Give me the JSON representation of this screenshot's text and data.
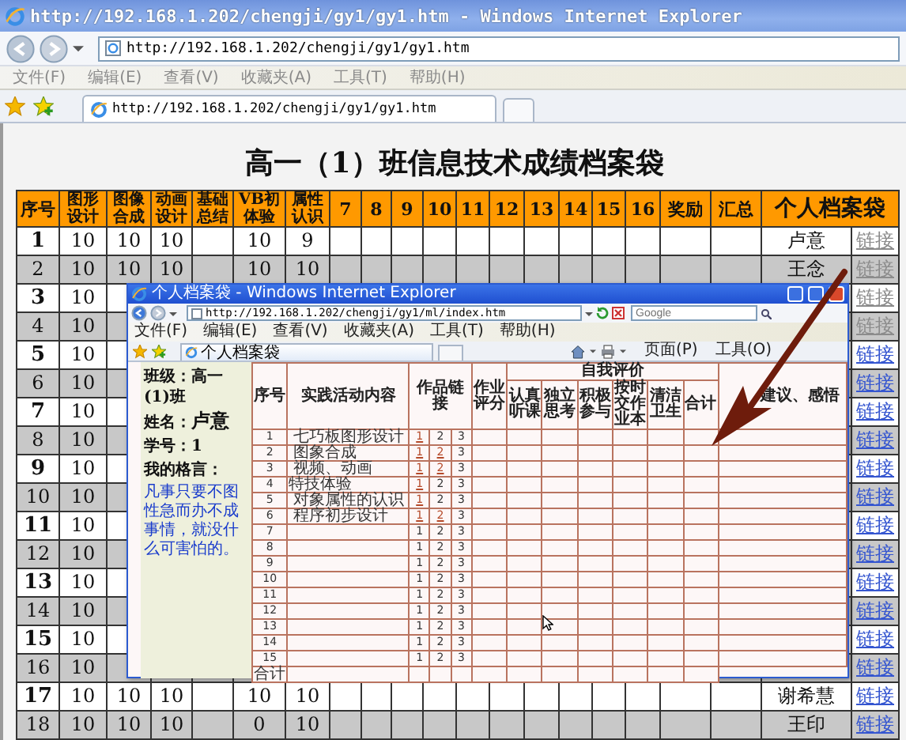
{
  "window": {
    "title": "http://192.168.1.202/chengji/gy1/gy1.htm - Windows Internet Explorer",
    "address": "http://192.168.1.202/chengji/gy1/gy1.htm",
    "menu": [
      "文件(F)",
      "编辑(E)",
      "查看(V)",
      "收藏夹(A)",
      "工具(T)",
      "帮助(H)"
    ],
    "tab": "http://192.168.1.202/chengji/gy1/gy1.htm"
  },
  "page": {
    "title": "高一（1）班信息技术成绩档案袋",
    "table": {
      "columns": [
        "序号",
        "图形设计",
        "图像合成",
        "动画设计",
        "基础总结",
        "VB初体验",
        "属性认识",
        "7",
        "8",
        "9",
        "10",
        "11",
        "12",
        "13",
        "14",
        "15",
        "16",
        "奖励",
        "汇总",
        "个人档案袋"
      ],
      "rows": [
        {
          "no": "1",
          "scores": [
            "10",
            "10",
            "10"
          ],
          "scores_after_gap": [
            "10",
            "9"
          ],
          "name": "卢意",
          "link": "链接",
          "visited": true
        },
        {
          "no": "2",
          "scores": [
            "10",
            "10",
            "10"
          ],
          "scores_after_gap": [
            "10",
            "10"
          ],
          "name": "王念",
          "link": "链接",
          "visited": true
        },
        {
          "no": "3",
          "scores": [
            "10"
          ],
          "link": "链接",
          "visited": true
        },
        {
          "no": "4",
          "scores": [
            "10"
          ],
          "link": "链接",
          "visited": true
        },
        {
          "no": "5",
          "scores": [
            "10"
          ],
          "link": "链接",
          "visited": false
        },
        {
          "no": "6",
          "scores": [
            "10"
          ],
          "link": "链接",
          "visited": false
        },
        {
          "no": "7",
          "scores": [
            "10"
          ],
          "link": "链接",
          "visited": false
        },
        {
          "no": "8",
          "scores": [
            "10"
          ],
          "link": "链接",
          "visited": false
        },
        {
          "no": "9",
          "scores": [
            "10"
          ],
          "link": "链接",
          "visited": false
        },
        {
          "no": "10",
          "scores": [
            "10"
          ],
          "link": "链接",
          "visited": false
        },
        {
          "no": "11",
          "scores": [
            "10"
          ],
          "link": "链接",
          "visited": false
        },
        {
          "no": "12",
          "scores": [
            "10"
          ],
          "link": "链接",
          "visited": false
        },
        {
          "no": "13",
          "scores": [
            "10"
          ],
          "link": "链接",
          "visited": false
        },
        {
          "no": "14",
          "scores": [
            "10"
          ],
          "link": "链接",
          "visited": false
        },
        {
          "no": "15",
          "scores": [
            "10"
          ],
          "link": "链接",
          "visited": false
        },
        {
          "no": "16",
          "scores": [
            "10"
          ],
          "link": "链接",
          "visited": false
        },
        {
          "no": "17",
          "scores": [
            "10",
            "10",
            "10"
          ],
          "scores_after_gap": [
            "10",
            "10"
          ],
          "name": "谢希慧",
          "link": "链接",
          "visited": false
        },
        {
          "no": "18",
          "scores": [
            "10",
            "10",
            "10"
          ],
          "scores_after_gap": [
            "0",
            "10"
          ],
          "name": "王印",
          "link": "链接",
          "visited": false
        }
      ]
    }
  },
  "popup": {
    "title": "个人档案袋 - Windows Internet Explorer",
    "address": "http://192.168.1.202/chengji/gy1/ml/index.htm",
    "search": {
      "placeholder": "Google"
    },
    "menu": [
      "文件(F)",
      "编辑(E)",
      "查看(V)",
      "收藏夹(A)",
      "工具(T)",
      "帮助(H)"
    ],
    "tab": "个人档案袋",
    "tools": [
      "页面(P)",
      "工具(O)"
    ],
    "profile": [
      {
        "label": "班级：",
        "value": "高一(1)班",
        "kind": "plain"
      },
      {
        "label": "姓名：",
        "value": "卢意",
        "kind": "large"
      },
      {
        "label": "学号：",
        "value": "1",
        "kind": "plain"
      }
    ],
    "motto": {
      "label": "我的格言：",
      "text": "凡事只要不图性急而办不成事情，就没什么可害怕的。"
    },
    "record": {
      "columns": [
        "序号",
        "实践活动内容",
        "作品链接",
        "作业评分"
      ],
      "self_eval": {
        "title": "自我评价",
        "items": [
          "认真听课",
          "独立思考",
          "积极参与",
          "按时交作业本",
          "清洁卫生",
          "合计"
        ]
      },
      "comments": "建议、感悟",
      "rows": [
        {
          "no": "1",
          "activity": "七巧板图形设计",
          "indented": true,
          "works": [
            {
              "label": "1",
              "linked": true
            },
            {
              "label": "2",
              "linked": false
            },
            {
              "label": "3",
              "linked": false
            }
          ]
        },
        {
          "no": "2",
          "activity": "图象合成",
          "indented": true,
          "works": [
            {
              "label": "1",
              "linked": true
            },
            {
              "label": "2",
              "linked": true
            },
            {
              "label": "3",
              "linked": false
            }
          ]
        },
        {
          "no": "3",
          "activity": "视频、动画",
          "indented": true,
          "works": [
            {
              "label": "1",
              "linked": true
            },
            {
              "label": "2",
              "linked": true
            },
            {
              "label": "3",
              "linked": false
            }
          ]
        },
        {
          "no": "4",
          "activity": "特技体验",
          "indented": false,
          "works": [
            {
              "label": "1",
              "linked": true
            },
            {
              "label": "2",
              "linked": false
            },
            {
              "label": "3",
              "linked": false
            }
          ]
        },
        {
          "no": "5",
          "activity": "对象属性的认识",
          "indented": true,
          "works": [
            {
              "label": "1",
              "linked": true
            },
            {
              "label": "2",
              "linked": false
            },
            {
              "label": "3",
              "linked": false
            }
          ]
        },
        {
          "no": "6",
          "activity": "程序初步设计",
          "indented": true,
          "works": [
            {
              "label": "1",
              "linked": true
            },
            {
              "label": "2",
              "linked": true
            },
            {
              "label": "3",
              "linked": false
            }
          ]
        },
        {
          "no": "7",
          "works": [
            {
              "label": "1",
              "linked": false
            },
            {
              "label": "2",
              "linked": false
            },
            {
              "label": "3",
              "linked": false
            }
          ]
        },
        {
          "no": "8",
          "works": [
            {
              "label": "1",
              "linked": false
            },
            {
              "label": "2",
              "linked": false
            },
            {
              "label": "3",
              "linked": false
            }
          ]
        },
        {
          "no": "9",
          "works": [
            {
              "label": "1",
              "linked": false
            },
            {
              "label": "2",
              "linked": false
            },
            {
              "label": "3",
              "linked": false
            }
          ]
        },
        {
          "no": "10",
          "works": [
            {
              "label": "1",
              "linked": false
            },
            {
              "label": "2",
              "linked": false
            },
            {
              "label": "3",
              "linked": false
            }
          ]
        },
        {
          "no": "11",
          "works": [
            {
              "label": "1",
              "linked": false
            },
            {
              "label": "2",
              "linked": false
            },
            {
              "label": "3",
              "linked": false
            }
          ]
        },
        {
          "no": "12",
          "works": [
            {
              "label": "1",
              "linked": false
            },
            {
              "label": "2",
              "linked": false
            },
            {
              "label": "3",
              "linked": false
            }
          ]
        },
        {
          "no": "13",
          "works": [
            {
              "label": "1",
              "linked": false
            },
            {
              "label": "2",
              "linked": false
            },
            {
              "label": "3",
              "linked": false
            }
          ]
        },
        {
          "no": "14",
          "works": [
            {
              "label": "1",
              "linked": false
            },
            {
              "label": "2",
              "linked": false
            },
            {
              "label": "3",
              "linked": false
            }
          ]
        },
        {
          "no": "15",
          "works": [
            {
              "label": "1",
              "linked": false
            },
            {
              "label": "2",
              "linked": false
            },
            {
              "label": "3",
              "linked": false
            }
          ]
        }
      ],
      "total_label": "合计"
    }
  }
}
